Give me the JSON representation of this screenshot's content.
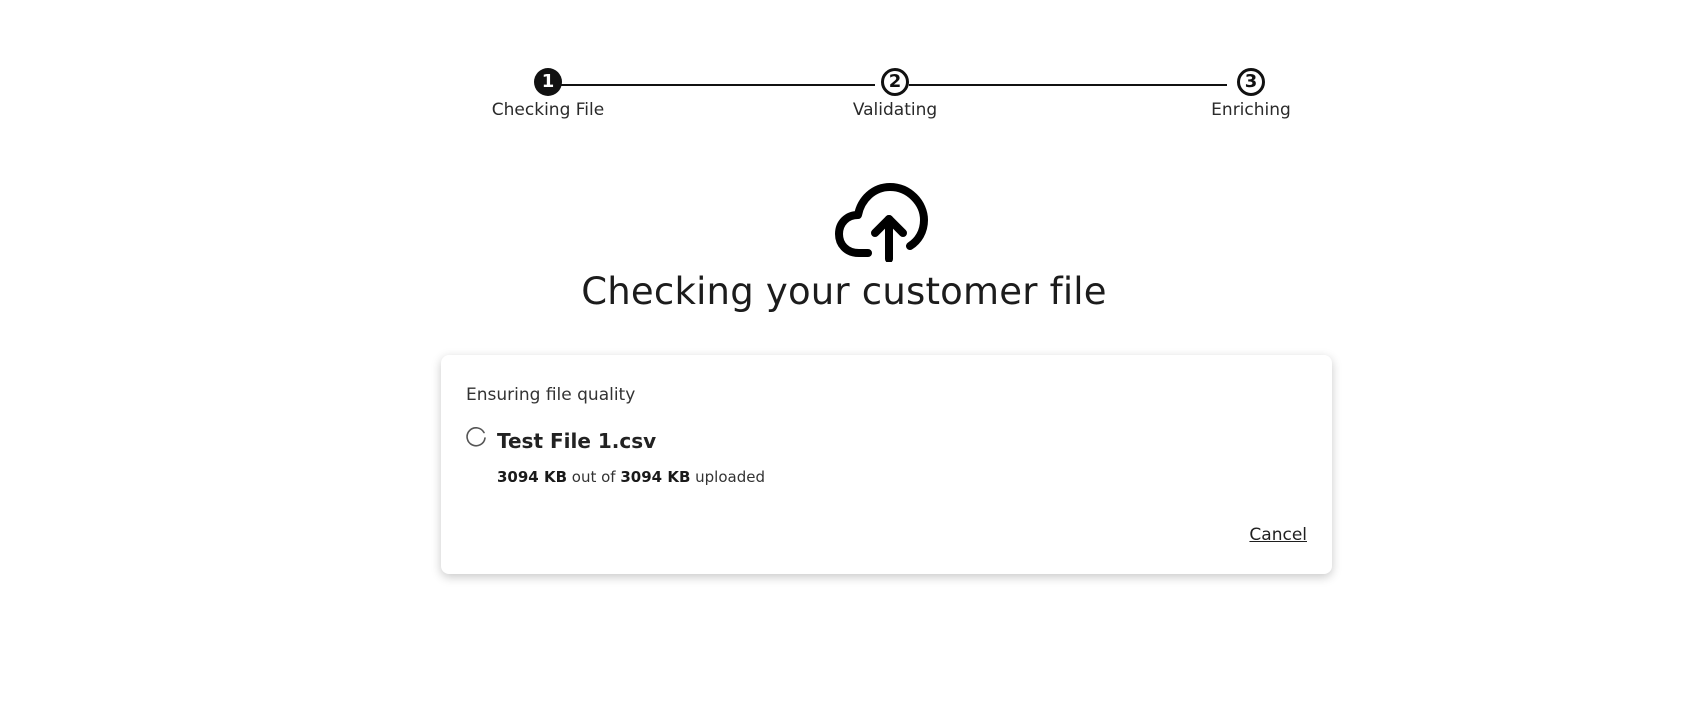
{
  "stepper": {
    "steps": [
      {
        "number": "1",
        "label": "Checking File",
        "state": "active"
      },
      {
        "number": "2",
        "label": "Validating",
        "state": "pending"
      },
      {
        "number": "3",
        "label": "Enriching",
        "state": "pending"
      }
    ]
  },
  "hero": {
    "icon": "cloud-upload-icon",
    "title": "Checking your customer file"
  },
  "card": {
    "subtitle": "Ensuring file quality",
    "file": {
      "name": "Test File 1.csv",
      "uploaded": "3094 KB",
      "out_of_text": " out of ",
      "total": "3094 KB",
      "uploaded_text": " uploaded",
      "status_icon": "loading-spinner-icon"
    },
    "cancel_label": "Cancel"
  },
  "colors": {
    "accent": "#111111",
    "text": "#1f1f1f",
    "background": "#ffffff"
  }
}
